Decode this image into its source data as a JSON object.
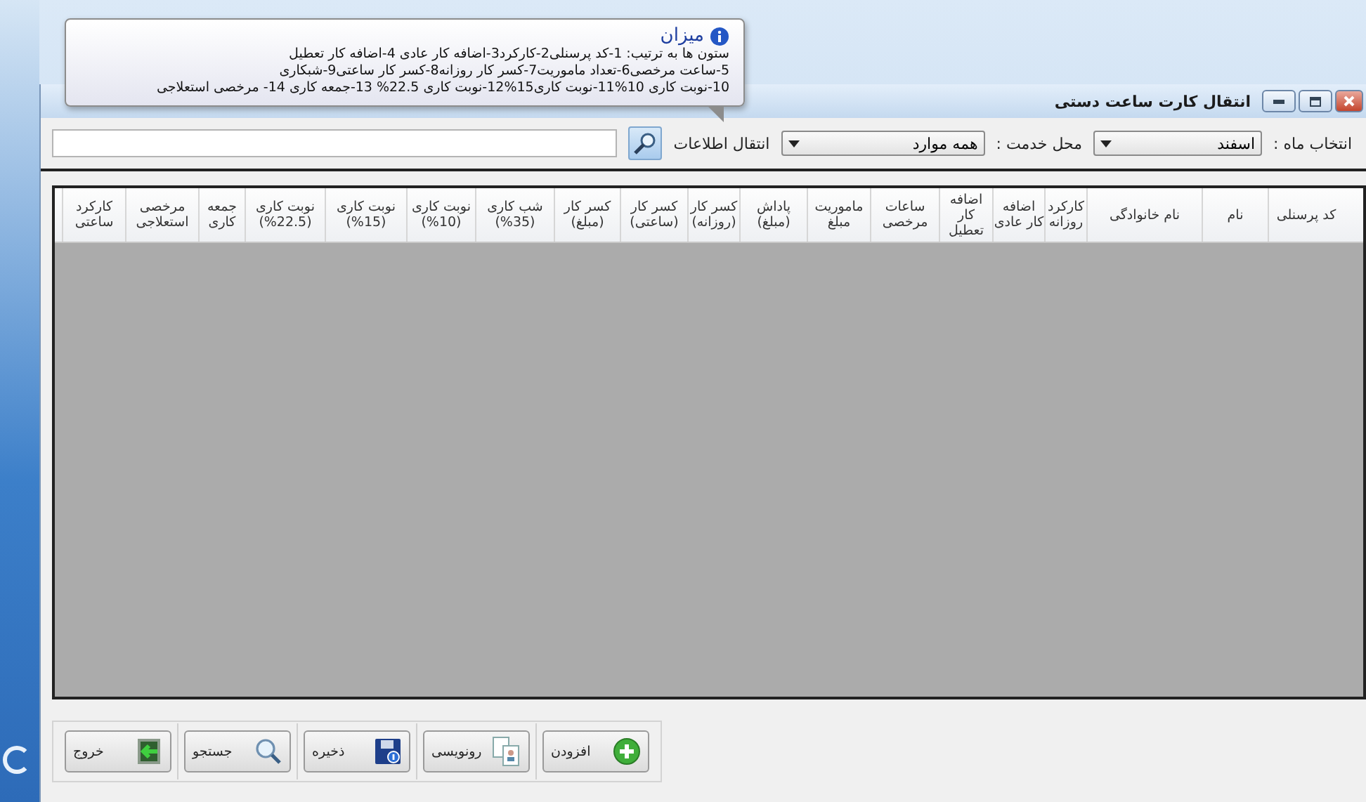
{
  "window": {
    "title": "انتقال کارت ساعت دستی"
  },
  "filters": {
    "month_label": "انتخاب ماه :",
    "month": "اسفند",
    "location_label": "محل خدمت :",
    "location": "همه موارد",
    "transfer_label": "انتقال اطلاعات"
  },
  "tooltip": {
    "title": "میزان",
    "lines": [
      "ستون ها به ترتیب: 1-کد پرسنلی2-کارکرد3-اضافه کار عادی 4-اضافه کار تعطیل",
      "5-ساعت مرخصی6-تعداد ماموریت7-کسر کار روزانه8-کسر کار ساعتی9-شبکاری",
      "10-نوبت کاری 10%11-نوبت کاری15%12-نوبت کاری 22.5% 13-جمعه کاری 14- مرخصی استعلاجی"
    ]
  },
  "table": {
    "columns": [
      "کد پرسنلی",
      "نام",
      "نام خانوادگی",
      "کارکرد روزانه",
      "اضافه کار عادی",
      "اضافه کار تعطیل",
      "ساعات مرخصی",
      "ماموریت مبلغ",
      "پاداش (مبلغ)",
      "کسر کار (روزانه)",
      "کسر کار (ساعتی)",
      "کسر کار (مبلغ)",
      "شب کاری (35%)",
      "نوبت کاری (10%)",
      "نوبت کاری (15%)",
      "نوبت کاری (22.5%)",
      "جمعه کاری",
      "مرخصی استعلاجی",
      "کارکرد ساعتی"
    ]
  },
  "buttons": [
    {
      "label": "افزودن",
      "kind": "add"
    },
    {
      "label": "رونویسی",
      "kind": "copy"
    },
    {
      "label": "ذخیره",
      "kind": "save"
    },
    {
      "label": "جستجو",
      "kind": "search"
    },
    {
      "label": "خروج",
      "kind": "exit"
    }
  ]
}
